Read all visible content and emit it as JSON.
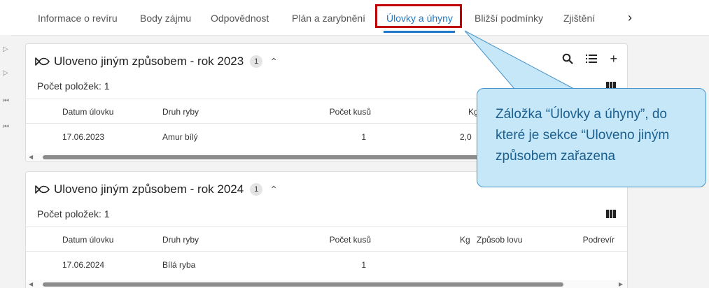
{
  "tabs": [
    {
      "label": "Informace o revíru",
      "active": false
    },
    {
      "label": "Body zájmu",
      "active": false
    },
    {
      "label": "Odpovědnost",
      "active": false
    },
    {
      "label": "Plán a zarybnění",
      "active": false
    },
    {
      "label": "Úlovky a úhyny",
      "active": true
    },
    {
      "label": "Bližší podmínky",
      "active": false
    },
    {
      "label": "Zjištění",
      "active": false
    }
  ],
  "tab_next_icon": "chevron-right-icon",
  "cards": [
    {
      "title": "Uloveno jiným způsobem - rok 2023",
      "badge": "1",
      "items_count": "Počet položek: 1",
      "columns": [
        "Datum úlovku",
        "Druh ryby",
        "Počet kusů",
        "Kg"
      ],
      "rows": [
        {
          "date": "17.06.2023",
          "species": "Amur bílý",
          "count": "1",
          "kg": "2,0"
        }
      ]
    },
    {
      "title": "Uloveno jiným způsobem - rok 2024",
      "badge": "1",
      "items_count": "Počet položek: 1",
      "columns": [
        "Datum úlovku",
        "Druh ryby",
        "Počet kusů",
        "Kg",
        "Způsob lovu",
        "Podrevír"
      ],
      "rows": [
        {
          "date": "17.06.2024",
          "species": "Bílá ryba",
          "count": "1"
        }
      ]
    }
  ],
  "callout": {
    "text": "Záložka “Úlovky a úhyny”, do které je sekce “Uloveno jiným způsobem zařazena"
  },
  "colors": {
    "accent": "#1f78c8",
    "highlight_frame": "#c00000",
    "callout_fill": "#c6e7f8",
    "callout_border": "#4a94c8"
  }
}
